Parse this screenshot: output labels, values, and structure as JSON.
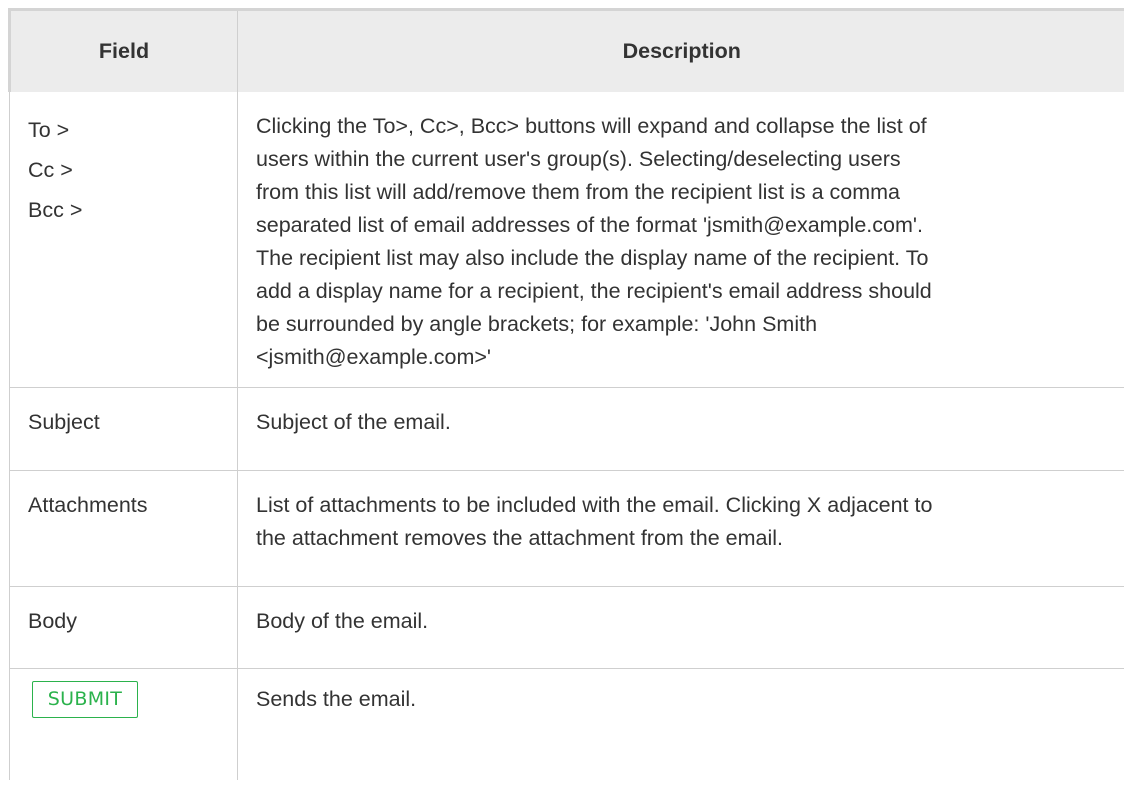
{
  "table": {
    "headers": {
      "field": "Field",
      "description": "Description"
    },
    "rows": {
      "recipients": {
        "fields": [
          "To >",
          "Cc >",
          "Bcc >"
        ],
        "description_lines": [
          "Clicking the To>, Cc>, Bcc> buttons will expand and collapse the list of",
          "users within the current user's group(s). Selecting/deselecting users",
          "from this list will add/remove them from the recipient list is a comma",
          "separated list of email addresses of the format 'jsmith@example.com'.",
          "The recipient list may also include the display name of the recipient. To",
          "add a display name for a recipient, the recipient's email address should",
          "be surrounded by angle brackets; for example: 'John Smith",
          "<jsmith@example.com>'"
        ]
      },
      "subject": {
        "field": "Subject",
        "description": "Subject of the email."
      },
      "attachments": {
        "field": "Attachments",
        "description_lines": [
          "List of attachments to be included with the email. Clicking X adjacent to",
          "the attachment removes the attachment from the email."
        ]
      },
      "body": {
        "field": "Body",
        "description": "Body of the email."
      },
      "submit": {
        "button_label": "SUBMIT",
        "description": "Sends the email."
      }
    }
  },
  "colors": {
    "header_bg": "#ececec",
    "border": "#cfcfcf",
    "text": "#333333",
    "submit_green": "#2bb24c"
  }
}
